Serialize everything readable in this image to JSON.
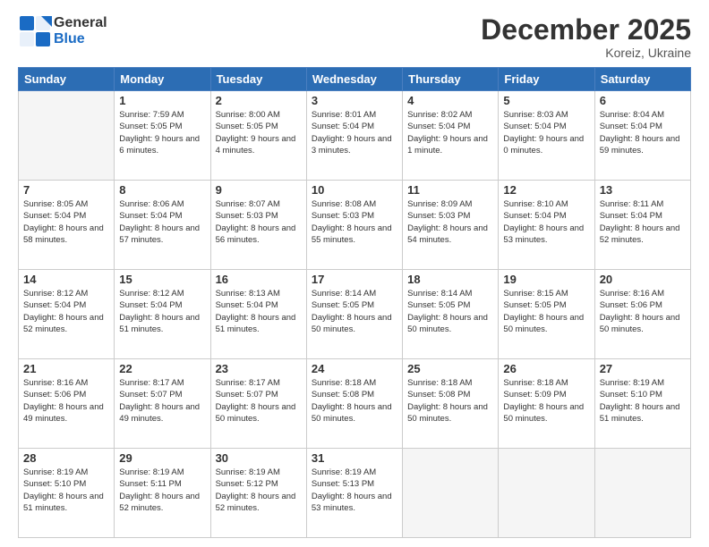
{
  "header": {
    "logo_general": "General",
    "logo_blue": "Blue",
    "month": "December 2025",
    "location": "Koreiz, Ukraine"
  },
  "days_of_week": [
    "Sunday",
    "Monday",
    "Tuesday",
    "Wednesday",
    "Thursday",
    "Friday",
    "Saturday"
  ],
  "weeks": [
    [
      {
        "day": "",
        "empty": true
      },
      {
        "day": "1",
        "sunrise": "Sunrise: 7:59 AM",
        "sunset": "Sunset: 5:05 PM",
        "daylight": "Daylight: 9 hours and 6 minutes."
      },
      {
        "day": "2",
        "sunrise": "Sunrise: 8:00 AM",
        "sunset": "Sunset: 5:05 PM",
        "daylight": "Daylight: 9 hours and 4 minutes."
      },
      {
        "day": "3",
        "sunrise": "Sunrise: 8:01 AM",
        "sunset": "Sunset: 5:04 PM",
        "daylight": "Daylight: 9 hours and 3 minutes."
      },
      {
        "day": "4",
        "sunrise": "Sunrise: 8:02 AM",
        "sunset": "Sunset: 5:04 PM",
        "daylight": "Daylight: 9 hours and 1 minute."
      },
      {
        "day": "5",
        "sunrise": "Sunrise: 8:03 AM",
        "sunset": "Sunset: 5:04 PM",
        "daylight": "Daylight: 9 hours and 0 minutes."
      },
      {
        "day": "6",
        "sunrise": "Sunrise: 8:04 AM",
        "sunset": "Sunset: 5:04 PM",
        "daylight": "Daylight: 8 hours and 59 minutes."
      }
    ],
    [
      {
        "day": "7",
        "sunrise": "Sunrise: 8:05 AM",
        "sunset": "Sunset: 5:04 PM",
        "daylight": "Daylight: 8 hours and 58 minutes."
      },
      {
        "day": "8",
        "sunrise": "Sunrise: 8:06 AM",
        "sunset": "Sunset: 5:04 PM",
        "daylight": "Daylight: 8 hours and 57 minutes."
      },
      {
        "day": "9",
        "sunrise": "Sunrise: 8:07 AM",
        "sunset": "Sunset: 5:03 PM",
        "daylight": "Daylight: 8 hours and 56 minutes."
      },
      {
        "day": "10",
        "sunrise": "Sunrise: 8:08 AM",
        "sunset": "Sunset: 5:03 PM",
        "daylight": "Daylight: 8 hours and 55 minutes."
      },
      {
        "day": "11",
        "sunrise": "Sunrise: 8:09 AM",
        "sunset": "Sunset: 5:03 PM",
        "daylight": "Daylight: 8 hours and 54 minutes."
      },
      {
        "day": "12",
        "sunrise": "Sunrise: 8:10 AM",
        "sunset": "Sunset: 5:04 PM",
        "daylight": "Daylight: 8 hours and 53 minutes."
      },
      {
        "day": "13",
        "sunrise": "Sunrise: 8:11 AM",
        "sunset": "Sunset: 5:04 PM",
        "daylight": "Daylight: 8 hours and 52 minutes."
      }
    ],
    [
      {
        "day": "14",
        "sunrise": "Sunrise: 8:12 AM",
        "sunset": "Sunset: 5:04 PM",
        "daylight": "Daylight: 8 hours and 52 minutes."
      },
      {
        "day": "15",
        "sunrise": "Sunrise: 8:12 AM",
        "sunset": "Sunset: 5:04 PM",
        "daylight": "Daylight: 8 hours and 51 minutes."
      },
      {
        "day": "16",
        "sunrise": "Sunrise: 8:13 AM",
        "sunset": "Sunset: 5:04 PM",
        "daylight": "Daylight: 8 hours and 51 minutes."
      },
      {
        "day": "17",
        "sunrise": "Sunrise: 8:14 AM",
        "sunset": "Sunset: 5:05 PM",
        "daylight": "Daylight: 8 hours and 50 minutes."
      },
      {
        "day": "18",
        "sunrise": "Sunrise: 8:14 AM",
        "sunset": "Sunset: 5:05 PM",
        "daylight": "Daylight: 8 hours and 50 minutes."
      },
      {
        "day": "19",
        "sunrise": "Sunrise: 8:15 AM",
        "sunset": "Sunset: 5:05 PM",
        "daylight": "Daylight: 8 hours and 50 minutes."
      },
      {
        "day": "20",
        "sunrise": "Sunrise: 8:16 AM",
        "sunset": "Sunset: 5:06 PM",
        "daylight": "Daylight: 8 hours and 50 minutes."
      }
    ],
    [
      {
        "day": "21",
        "sunrise": "Sunrise: 8:16 AM",
        "sunset": "Sunset: 5:06 PM",
        "daylight": "Daylight: 8 hours and 49 minutes."
      },
      {
        "day": "22",
        "sunrise": "Sunrise: 8:17 AM",
        "sunset": "Sunset: 5:07 PM",
        "daylight": "Daylight: 8 hours and 49 minutes."
      },
      {
        "day": "23",
        "sunrise": "Sunrise: 8:17 AM",
        "sunset": "Sunset: 5:07 PM",
        "daylight": "Daylight: 8 hours and 50 minutes."
      },
      {
        "day": "24",
        "sunrise": "Sunrise: 8:18 AM",
        "sunset": "Sunset: 5:08 PM",
        "daylight": "Daylight: 8 hours and 50 minutes."
      },
      {
        "day": "25",
        "sunrise": "Sunrise: 8:18 AM",
        "sunset": "Sunset: 5:08 PM",
        "daylight": "Daylight: 8 hours and 50 minutes."
      },
      {
        "day": "26",
        "sunrise": "Sunrise: 8:18 AM",
        "sunset": "Sunset: 5:09 PM",
        "daylight": "Daylight: 8 hours and 50 minutes."
      },
      {
        "day": "27",
        "sunrise": "Sunrise: 8:19 AM",
        "sunset": "Sunset: 5:10 PM",
        "daylight": "Daylight: 8 hours and 51 minutes."
      }
    ],
    [
      {
        "day": "28",
        "sunrise": "Sunrise: 8:19 AM",
        "sunset": "Sunset: 5:10 PM",
        "daylight": "Daylight: 8 hours and 51 minutes."
      },
      {
        "day": "29",
        "sunrise": "Sunrise: 8:19 AM",
        "sunset": "Sunset: 5:11 PM",
        "daylight": "Daylight: 8 hours and 52 minutes."
      },
      {
        "day": "30",
        "sunrise": "Sunrise: 8:19 AM",
        "sunset": "Sunset: 5:12 PM",
        "daylight": "Daylight: 8 hours and 52 minutes."
      },
      {
        "day": "31",
        "sunrise": "Sunrise: 8:19 AM",
        "sunset": "Sunset: 5:13 PM",
        "daylight": "Daylight: 8 hours and 53 minutes."
      },
      {
        "day": "",
        "empty": true
      },
      {
        "day": "",
        "empty": true
      },
      {
        "day": "",
        "empty": true
      }
    ]
  ]
}
